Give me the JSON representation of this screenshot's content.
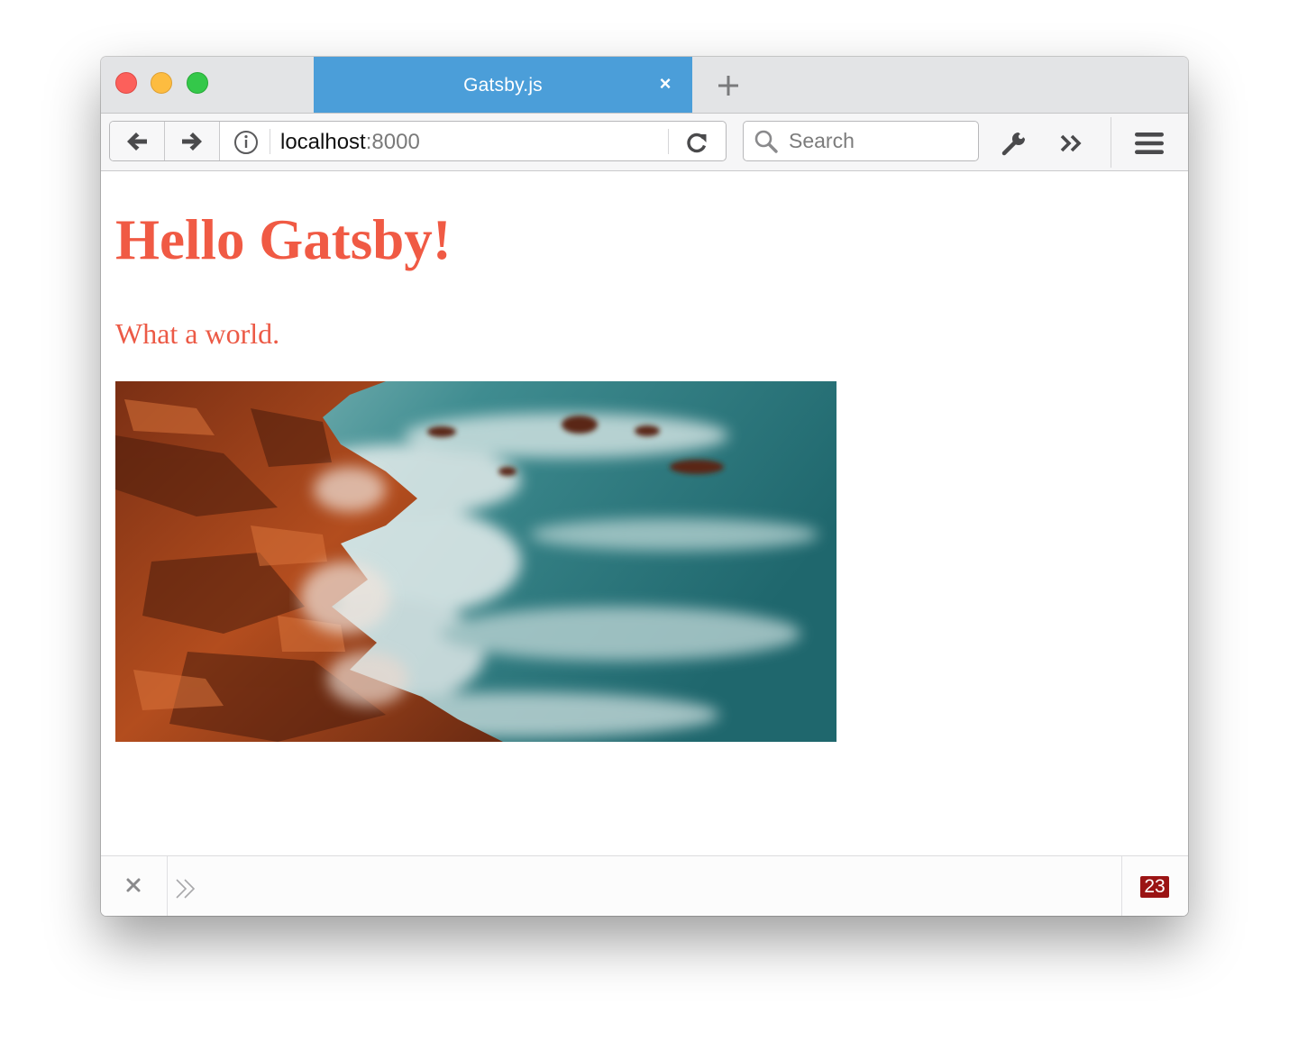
{
  "browser": {
    "tab": {
      "title": "Gatsby.js",
      "close_glyph": "×",
      "close_icon": "close-icon"
    },
    "new_tab_icon": "plus-icon",
    "toolbar": {
      "back_icon": "arrow-left-icon",
      "forward_icon": "arrow-right-icon",
      "info_icon": "info-icon",
      "url_host": "localhost",
      "url_port": ":8000",
      "reload_icon": "reload-icon",
      "search_placeholder": "Search",
      "search_icon": "search-icon",
      "devtools_icon": "wrench-icon",
      "overflow_icon": "double-chevron-right-icon",
      "menu_icon": "hamburger-menu-icon"
    },
    "console": {
      "close_icon": "close-icon",
      "prompt_icon": "double-chevron-right-icon",
      "error_count": "23"
    }
  },
  "page": {
    "heading": "Hello Gatsby!",
    "subtitle": "What a world.",
    "image": "rocky-coastline-photo"
  },
  "colors": {
    "tab_active": "#4b9ed9",
    "heading": "#f05a44",
    "error_badge": "#9b1414"
  }
}
